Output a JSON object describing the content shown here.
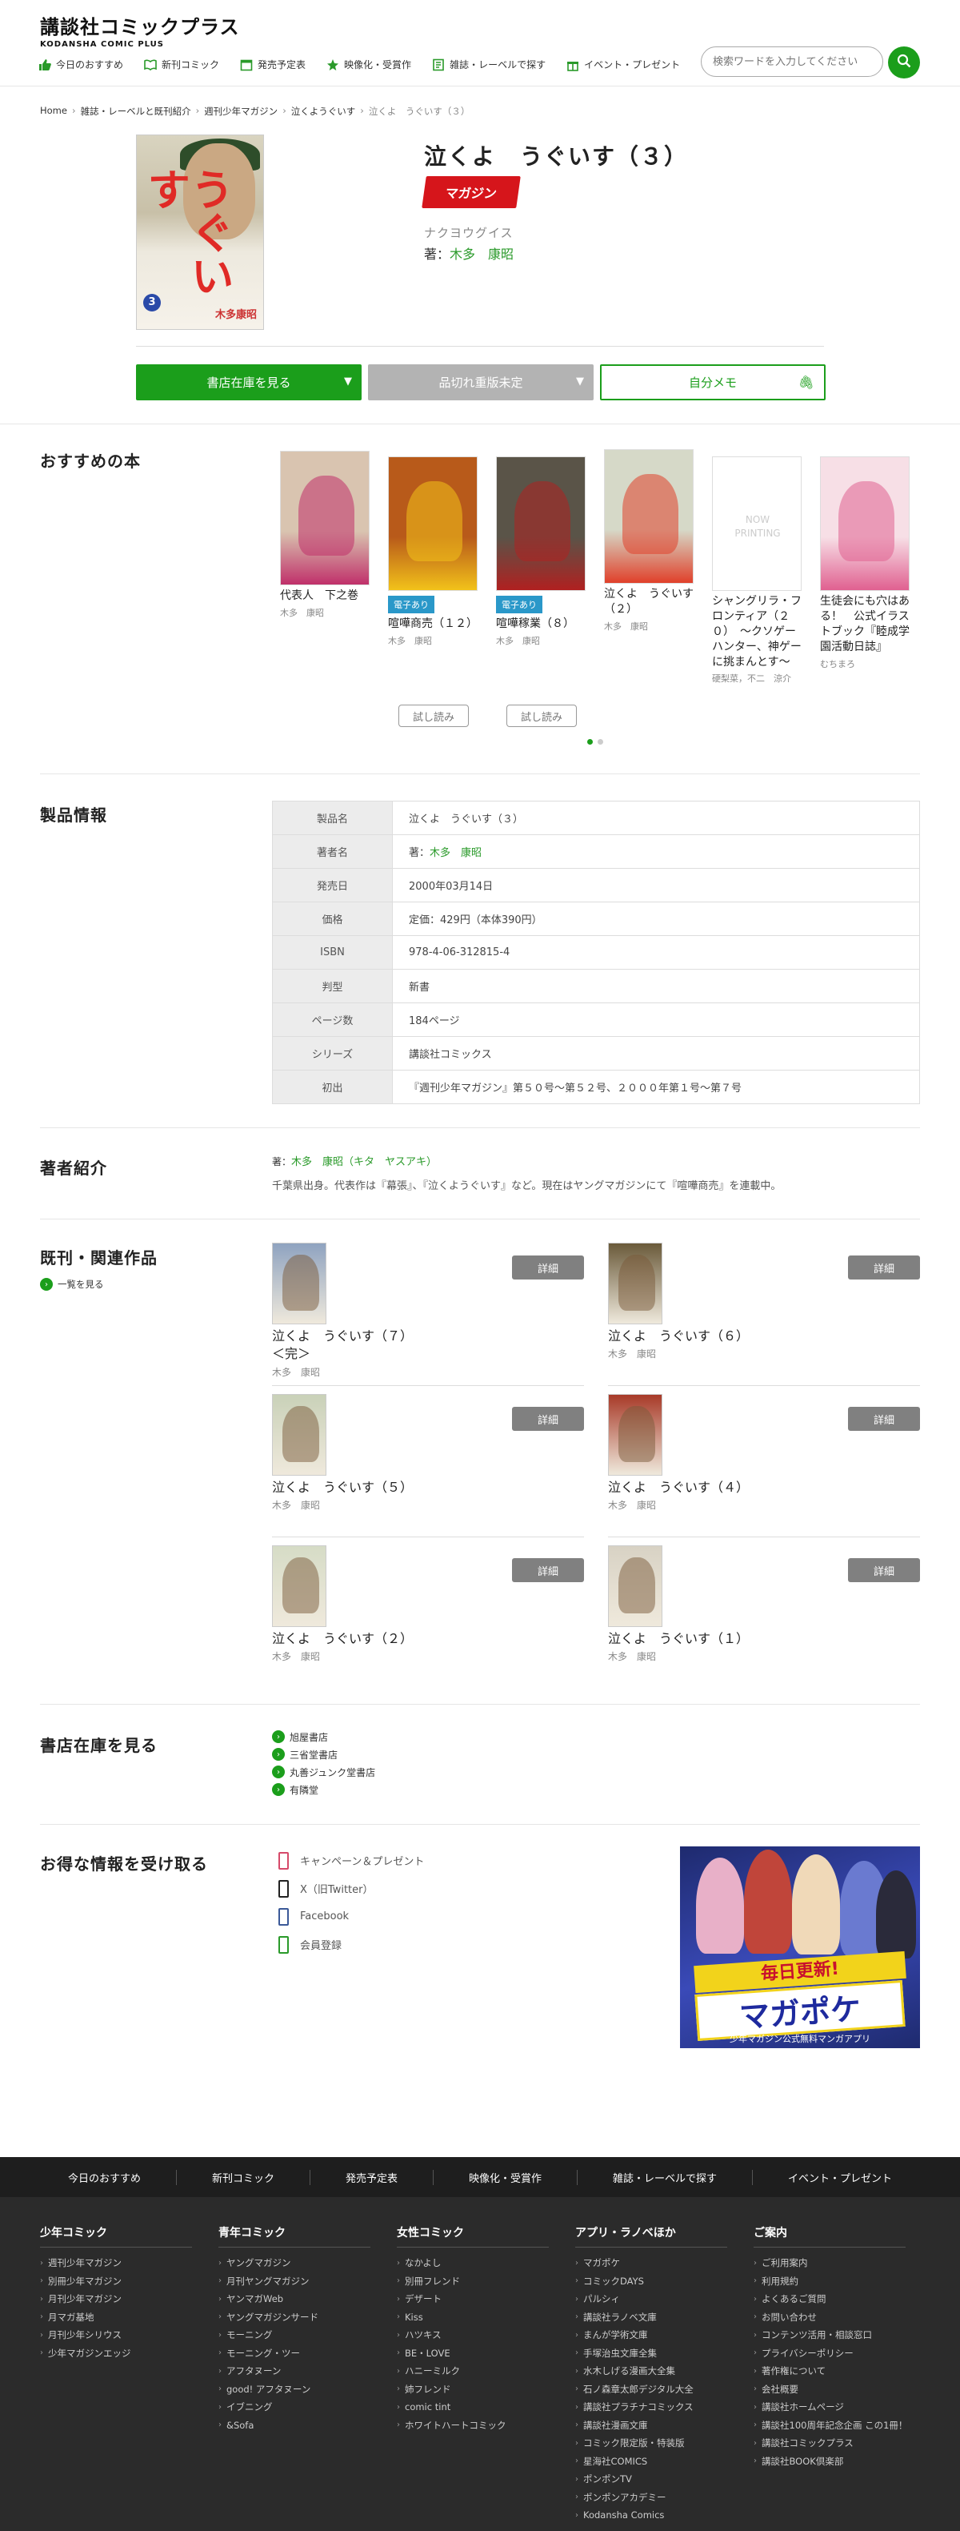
{
  "header": {
    "logo_jp": "講談社コミックプラス",
    "logo_en": "KODANSHA COMIC PLUS",
    "nav": [
      {
        "label": "今日のおすすめ",
        "icon": "thumbs-up-icon"
      },
      {
        "label": "新刊コミック",
        "icon": "book-icon"
      },
      {
        "label": "発売予定表",
        "icon": "calendar-icon"
      },
      {
        "label": "映像化・受賞作",
        "icon": "star-icon"
      },
      {
        "label": "雑誌・レーベルで探す",
        "icon": "magazine-icon"
      },
      {
        "label": "イベント・プレゼント",
        "icon": "gift-icon"
      }
    ],
    "search_placeholder": "検索ワードを入力してください"
  },
  "breadcrumb": [
    "Home",
    "雑誌・レーベルと既刊紹介",
    "週刊少年マガジン",
    "泣くようぐいす",
    "泣くよ　うぐいす（３）"
  ],
  "product": {
    "title": "泣くよ　うぐいす（３）",
    "magazine_logo": "マガジン",
    "kana": "ナクヨウグイス",
    "author_prefix": "著：",
    "author": "木多　康昭",
    "cover_title": "うぐいす",
    "cover_volume": "3",
    "cover_author": "木多康昭",
    "buttons": {
      "stock": "書店在庫を見る",
      "out_of_stock": "品切れ重版未定",
      "memo": "自分メモ"
    }
  },
  "recommend": {
    "title": "おすすめの本",
    "items": [
      {
        "title": "代表人　下之巻",
        "author": "木多　康昭",
        "badge": "",
        "color": "#d9c4b0",
        "accent": "#c0306a"
      },
      {
        "title": "喧嘩商売（１２）",
        "author": "木多　康昭",
        "badge": "電子あり",
        "color": "#b85a1a",
        "accent": "#f2c21a"
      },
      {
        "title": "喧嘩稼業（８）",
        "author": "木多　康昭",
        "badge": "電子あり",
        "color": "#5a5448",
        "accent": "#b02020"
      },
      {
        "title": "泣くよ　うぐいす（２）",
        "author": "木多　康昭",
        "badge": "",
        "color": "#d6d9c8",
        "accent": "#e0402a"
      },
      {
        "title": "シャングリラ・フロンティア（２０）　～クソゲーハンター、神ゲーに挑まんとす～",
        "author": "硬梨菜，不二　涼介",
        "badge": "",
        "color": "#ffffff",
        "accent": "#dddddd",
        "nowprinting": "NOW PRINTING"
      },
      {
        "title": "生徒会にも穴はある！　公式イラストブック『睦成学園活動日誌』",
        "author": "むちまろ",
        "badge": "",
        "color": "#f7dfe6",
        "accent": "#e06090"
      }
    ],
    "trial_label": "試し読み"
  },
  "product_info": {
    "title": "製品情報",
    "rows": [
      {
        "key": "製品名",
        "value": "泣くよ　うぐいす（３）"
      },
      {
        "key": "著者名",
        "value": "著：",
        "link": "木多　康昭"
      },
      {
        "key": "発売日",
        "value": "2000年03月14日"
      },
      {
        "key": "価格",
        "value": "定価：429円（本体390円）"
      },
      {
        "key": "ISBN",
        "value": "978-4-06-312815-4"
      },
      {
        "key": "判型",
        "value": "新書"
      },
      {
        "key": "ページ数",
        "value": "184ページ"
      },
      {
        "key": "シリーズ",
        "value": "講談社コミックス"
      },
      {
        "key": "初出",
        "value": "『週刊少年マガジン』第５０号～第５２号、２０００年第１号～第７号"
      }
    ]
  },
  "author_intro": {
    "title": "著者紹介",
    "prefix": "著：",
    "name": "木多　康昭（キタ　ヤスアキ）",
    "desc": "千葉県出身。代表作は『幕張』、『泣くようぐいす』など。現在はヤングマガジンにて『喧嘩商売』を連載中。"
  },
  "related": {
    "title": "既刊・関連作品",
    "list_link": "一覧を見る",
    "detail_label": "詳細",
    "items": [
      {
        "title": "泣くよ　うぐいす（７）＜完＞",
        "author": "木多　康昭",
        "color": "#8fa3c0"
      },
      {
        "title": "泣くよ　うぐいす（６）",
        "author": "木多　康昭",
        "color": "#6a5a3a"
      },
      {
        "title": "泣くよ　うぐいす（５）",
        "author": "木多　康昭",
        "color": "#c9d1b8"
      },
      {
        "title": "泣くよ　うぐいす（４）",
        "author": "木多　康昭",
        "color": "#a83a28"
      },
      {
        "title": "泣くよ　うぐいす（２）",
        "author": "木多　康昭",
        "color": "#d6dcc6"
      },
      {
        "title": "泣くよ　うぐいす（１）",
        "author": "木多　康昭",
        "color": "#d8d2c4"
      }
    ]
  },
  "stores": {
    "title": "書店在庫を見る",
    "items": [
      "旭屋書店",
      "三省堂書店",
      "丸善ジュンク堂書店",
      "有隣堂"
    ]
  },
  "info": {
    "title": "お得な情報を受け取る",
    "links": [
      {
        "label": "キャンペーン＆プレゼント",
        "color": "#d64a6a"
      },
      {
        "label": "X（旧Twitter）",
        "color": "#222222"
      },
      {
        "label": "Facebook",
        "color": "#3b5998"
      },
      {
        "label": "会員登録",
        "color": "#2a9a2a"
      }
    ],
    "banner": {
      "ribbon": "毎日更新!",
      "brand": "マガポケ",
      "sub": "少年マガジン公式無料マンガアプリ"
    }
  },
  "footer": {
    "nav": [
      "今日のおすすめ",
      "新刊コミック",
      "発売予定表",
      "映像化・受賞作",
      "雑誌・レーベルで探す",
      "イベント・プレゼント"
    ],
    "columns": [
      {
        "title": "少年コミック",
        "items": [
          "週刊少年マガジン",
          "別冊少年マガジン",
          "月刊少年マガジン",
          "月マガ基地",
          "月刊少年シリウス",
          "少年マガジンエッジ"
        ]
      },
      {
        "title": "青年コミック",
        "items": [
          "ヤングマガジン",
          "月刊ヤングマガジン",
          "ヤンマガWeb",
          "ヤングマガジンサード",
          "モーニング",
          "モーニング・ツー",
          "アフタヌーン",
          "good! アフタヌーン",
          "イブニング",
          "&Sofa"
        ]
      },
      {
        "title": "女性コミック",
        "items": [
          "なかよし",
          "別冊フレンド",
          "デザート",
          "Kiss",
          "ハツキス",
          "BE・LOVE",
          "ハニーミルク",
          "姉フレンド",
          "comic tint",
          "ホワイトハートコミック"
        ]
      },
      {
        "title": "アプリ・ラノベほか",
        "items": [
          "マガポケ",
          "コミックDAYS",
          "パルシィ",
          "講談社ラノベ文庫",
          "まんが学術文庫",
          "手塚治虫文庫全集",
          "水木しげる漫画大全集",
          "石ノ森章太郎デジタル大全",
          "講談社プラチナコミックス",
          "講談社漫画文庫",
          "コミック限定版・特装版",
          "星海社COMICS",
          "ポンポンTV",
          "ポンポンアカデミー",
          "Kodansha Comics"
        ]
      },
      {
        "title": "ご案内",
        "items": [
          "ご利用案内",
          "利用規約",
          "よくあるご質問",
          "お問い合わせ",
          "コンテンツ活用・相談窓口",
          "プライバシーポリシー",
          "著作権について",
          "会社概要",
          "講談社ホームページ",
          "講談社100周年記念企画 この1冊！",
          "講談社コミックプラス",
          "講談社BOOK倶楽部"
        ]
      }
    ]
  }
}
